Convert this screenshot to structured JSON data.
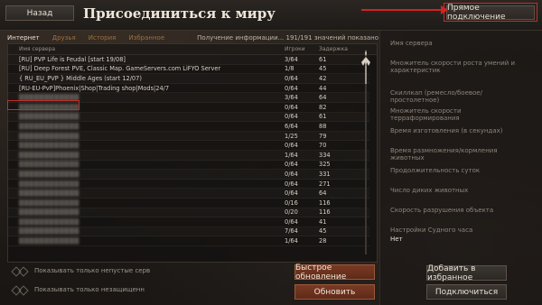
{
  "top": {
    "back_label": "Назад",
    "title": "Присоединиться к миру",
    "direct_connect_label": "Прямое подключение"
  },
  "tabs": [
    {
      "label": "Интернет",
      "active": true
    },
    {
      "label": "Друзья",
      "active": false
    },
    {
      "label": "История",
      "active": false
    },
    {
      "label": "Избранное",
      "active": false
    }
  ],
  "status_text": "Получение информации... 191/191 значений показано",
  "columns": {
    "name": "Имя сервера",
    "players": "Игроки",
    "ping": "Задержка"
  },
  "rows": [
    {
      "name": "[RU] PVP Life is Feudal [start 19/08]",
      "players": "3/64",
      "ping": "61",
      "blurred": false
    },
    {
      "name": "[RU] Deep Forest PVE, Classic Map. GameServers.com LiFYO Server",
      "players": "1/8",
      "ping": "45",
      "blurred": false
    },
    {
      "name": "{ RU_EU_PVP } Middle  Ages (start 12/07)",
      "players": "0/64",
      "ping": "42",
      "blurred": false
    },
    {
      "name": "[RU-EU-PvP]Phoenix|Shop|Trading shop|Mods|24/7",
      "players": "0/64",
      "ping": "44",
      "blurred": false
    },
    {
      "name": "",
      "players": "3/64",
      "ping": "64",
      "blurred": true
    },
    {
      "name": "",
      "players": "0/64",
      "ping": "82",
      "blurred": true
    },
    {
      "name": "",
      "players": "0/64",
      "ping": "61",
      "blurred": true
    },
    {
      "name": "",
      "players": "6/64",
      "ping": "88",
      "blurred": true
    },
    {
      "name": "",
      "players": "1/25",
      "ping": "79",
      "blurred": true
    },
    {
      "name": "",
      "players": "0/64",
      "ping": "70",
      "blurred": true
    },
    {
      "name": "",
      "players": "1/64",
      "ping": "334",
      "blurred": true
    },
    {
      "name": "",
      "players": "0/64",
      "ping": "325",
      "blurred": true
    },
    {
      "name": "",
      "players": "0/64",
      "ping": "331",
      "blurred": true
    },
    {
      "name": "",
      "players": "0/64",
      "ping": "271",
      "blurred": true
    },
    {
      "name": "",
      "players": "0/64",
      "ping": "64",
      "blurred": true
    },
    {
      "name": "",
      "players": "0/16",
      "ping": "116",
      "blurred": true
    },
    {
      "name": "",
      "players": "0/20",
      "ping": "116",
      "blurred": true
    },
    {
      "name": "",
      "players": "0/64",
      "ping": "41",
      "blurred": true
    },
    {
      "name": "",
      "players": "7/64",
      "ping": "45",
      "blurred": true
    },
    {
      "name": "",
      "players": "1/64",
      "ping": "28",
      "blurred": true
    }
  ],
  "filters": [
    "Показывать только непустые серв",
    "Показывать только незащищенн"
  ],
  "buttons": {
    "quick_refresh": "Быстрое обновление",
    "refresh": "Обновить",
    "add_favorite": "Добавить в избранное",
    "connect": "Подключиться"
  },
  "details": [
    {
      "label": "Имя сервера",
      "value": ""
    },
    {
      "label": "Множитель скорости роста умений и характеристик",
      "value": ""
    },
    {
      "label": "Скиллкап (ремесло/боевое/простолетное)",
      "value": ""
    },
    {
      "label": "Множитель скорости терраформирования",
      "value": ""
    },
    {
      "label": "Время изготовления (в секундах)",
      "value": ""
    },
    {
      "label": "Время размножения/кормления животных",
      "value": ""
    },
    {
      "label": "Продолжительность суток",
      "value": ""
    },
    {
      "label": "Число диких животных",
      "value": ""
    },
    {
      "label": "Скорость разрушения объекта",
      "value": ""
    },
    {
      "label": "Настройки Судного часа",
      "value": "Нет"
    }
  ]
}
